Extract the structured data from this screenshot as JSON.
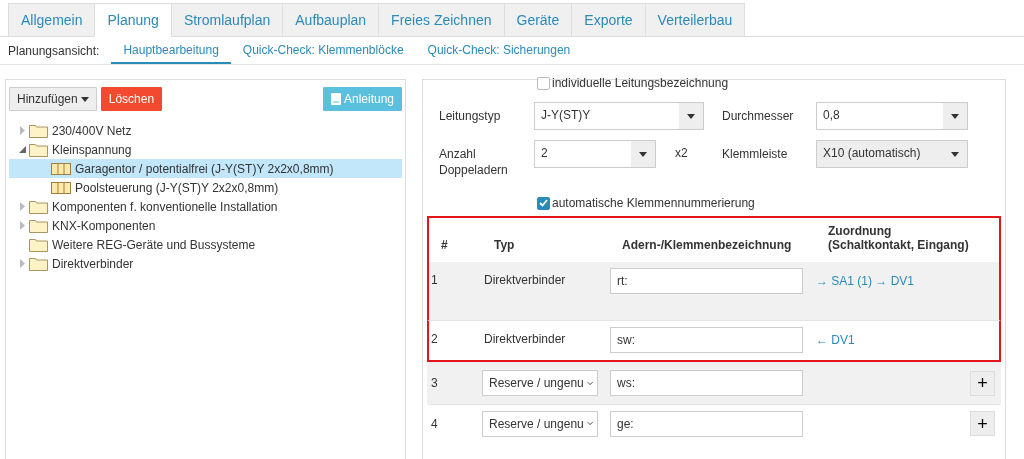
{
  "tabs": [
    {
      "label": "Allgemein",
      "selected": false
    },
    {
      "label": "Planung",
      "selected": true
    },
    {
      "label": "Stromlaufplan",
      "selected": false
    },
    {
      "label": "Aufbauplan",
      "selected": false
    },
    {
      "label": "Freies Zeichnen",
      "selected": false
    },
    {
      "label": "Geräte",
      "selected": false
    },
    {
      "label": "Exporte",
      "selected": false
    },
    {
      "label": "Verteilerbau",
      "selected": false
    }
  ],
  "subnav": {
    "label": "Planungsansicht:",
    "items": [
      {
        "label": "Hauptbearbeitung",
        "selected": true
      },
      {
        "label": "Quick-Check: Klemmenblöcke",
        "selected": false
      },
      {
        "label": "Quick-Check: Sicherungen",
        "selected": false
      }
    ]
  },
  "toolbar": {
    "add_button": "Hinzufügen",
    "delete_button": "Löschen",
    "help_button": "Anleitung"
  },
  "tree": [
    {
      "label": "230/400V Netz",
      "kind": "folder",
      "expanded": false,
      "selected": false
    },
    {
      "label": "Kleinspannung",
      "kind": "folder",
      "expanded": true,
      "selected": false,
      "children": [
        {
          "label": "Garagentor / potentialfrei (J-Y(ST)Y 2x2x0,8mm)",
          "kind": "cable",
          "selected": true
        },
        {
          "label": "Poolsteuerung (J-Y(ST)Y 2x2x0,8mm)",
          "kind": "cable",
          "selected": false
        }
      ]
    },
    {
      "label": "Komponenten f. konventionelle Installation",
      "kind": "folder",
      "expanded": false,
      "selected": false
    },
    {
      "label": "KNX-Komponenten",
      "kind": "folder",
      "expanded": false,
      "selected": false
    },
    {
      "label": "Weitere REG-Geräte und Bussysteme",
      "kind": "folder",
      "selected": false
    },
    {
      "label": "Direktverbinder",
      "kind": "folder",
      "expanded": false,
      "selected": false
    }
  ],
  "form": {
    "individual_name": {
      "label": "individuelle Leitungsbezeichnung",
      "checked": false
    },
    "fields": [
      {
        "label": "Leitungstyp",
        "value": "J-Y(ST)Y",
        "disabled": false
      },
      {
        "label": "Durchmesser",
        "value": "0,8",
        "disabled": false
      },
      {
        "label": "Anzahl Doppeladern",
        "value": "2",
        "suffix": "x2",
        "disabled": false
      },
      {
        "label": "Klemmleiste",
        "value": "X10 (automatisch)",
        "disabled": true
      }
    ],
    "auto_numbering": {
      "label": "automatische Klemmennummerierung",
      "checked": true
    }
  },
  "table": {
    "highlighted": true,
    "columns": [
      "#",
      "Typ",
      "Adern-/Klemmenbezeichnung",
      "Zuordnung (Schaltkontakt, Eingang)"
    ],
    "rows": [
      {
        "number": "1",
        "kind": "fixed",
        "type": "Direktverbinder",
        "label": "rt:",
        "assignment": "→ SA1 (1) → DV1",
        "highlighted": true
      },
      {
        "number": "2",
        "kind": "fixed",
        "type": "Direktverbinder",
        "label": "sw:",
        "assignment": "← DV1",
        "highlighted": true
      },
      {
        "number": "3",
        "kind": "reserve",
        "type": "Reserve / ungenu",
        "label": "ws:",
        "action": "+",
        "highlighted": false
      },
      {
        "number": "4",
        "kind": "reserve",
        "type": "Reserve / ungenu",
        "label": "ge:",
        "action": "+",
        "highlighted": false
      }
    ]
  }
}
